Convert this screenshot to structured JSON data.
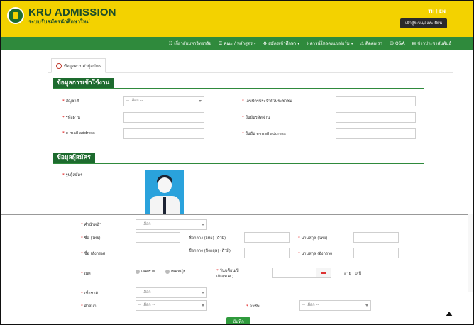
{
  "header": {
    "brand_title": "KRU ADMISSION",
    "brand_subtitle": "ระบบรับสมัครนักศึกษาใหม่",
    "lang": "TH | EN",
    "login_label": "เข้าสู่ระบบ/ลงทะเบียน"
  },
  "nav": {
    "items": [
      "☷ เกี่ยวกับมหาวิทยาลัย",
      "☰ คณะ / หลักสูตร ▾",
      "♻ สมัครเข้าศึกษา ▾",
      "⤓ ดาวน์โหลดแบบฟอร์ม ▾",
      "⚠ ติดต่อเรา",
      "☺ Q&A",
      "▤ ข่าวประชาสัมพันธ์"
    ]
  },
  "tab": {
    "label": "ข้อมูลส่วนตัวผู้สมัคร"
  },
  "section_login": {
    "title": "ข้อมูลการเข้าใช้งาน",
    "nationality_label": "สัญชาติ",
    "nationality_value": "-- เลือก --",
    "idcard_label": "เลขบัตรประจำตัวประชาชน",
    "password_label": "รหัสผ่าน",
    "confirm_password_label": "ยืนยันรหัสผ่าน",
    "email_label": "e-mail address",
    "confirm_email_label": "ยืนยัน e-mail address"
  },
  "section_applicant": {
    "title": "ข้อมูลผู้สมัคร",
    "photo_label": "รูปผู้สมัคร",
    "prefix_label": "คำนำหน้า",
    "prefix_value": "-- เลือก --",
    "fname_th_label": "ชื่อ (ไทย)",
    "mname_th_label": "ชื่อกลาง (ไทย) (ถ้ามี)",
    "lname_th_label": "นามสกุล (ไทย)",
    "fname_en_label": "ชื่อ (อังกฤษ)",
    "mname_en_label": "ชื่อกลาง (อังกฤษ) (ถ้ามี)",
    "lname_en_label": "นามสกุล (อังกฤษ)",
    "gender_label": "เพศ",
    "gender_male": "เพศชาย",
    "gender_female": "เพศหญิง",
    "dob_label": "วัน/เดือน/ปีเกิด(พ.ศ.)",
    "age_text": "อายุ : 0 ปี",
    "ethnicity_label": "เชื้อชาติ",
    "ethnicity_value": "-- เลือก --",
    "religion_label": "ศาสนา",
    "religion_value": "-- เลือก --",
    "occupation_label": "อาชีพ",
    "occupation_value": "-- เลือก --"
  },
  "actions": {
    "save_label": "บันทึก"
  }
}
